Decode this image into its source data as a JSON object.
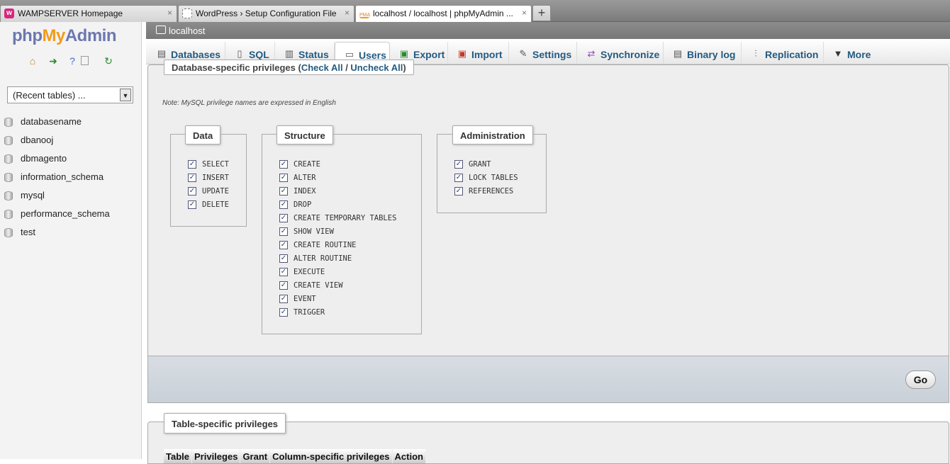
{
  "browser": {
    "tabs": [
      {
        "title": "WAMPSERVER Homepage",
        "close": "×"
      },
      {
        "title": "WordPress › Setup Configuration File",
        "close": "×"
      },
      {
        "title": "localhost / localhost | phpMyAdmin ...",
        "close": "×"
      }
    ],
    "new_tab": "+"
  },
  "sidebar": {
    "logo": {
      "php": "php",
      "my": "My",
      "admin": "Admin"
    },
    "recent_tables": "(Recent tables) ...",
    "databases": [
      "databasename",
      "dbanooj",
      "dbmagento",
      "information_schema",
      "mysql",
      "performance_schema",
      "test"
    ]
  },
  "server": {
    "name": "localhost"
  },
  "menu": [
    "Databases",
    "SQL",
    "Status",
    "Users",
    "Export",
    "Import",
    "Settings",
    "Synchronize",
    "Binary log",
    "Replication",
    "More"
  ],
  "db_privileges": {
    "legend": "Database-specific privileges",
    "check_all": "Check All",
    "separator": " / ",
    "uncheck_all": "Uncheck All",
    "note": "Note: MySQL privilege names are expressed in English",
    "groups": {
      "data": {
        "label": "Data",
        "items": [
          "SELECT",
          "INSERT",
          "UPDATE",
          "DELETE"
        ]
      },
      "structure": {
        "label": "Structure",
        "items": [
          "CREATE",
          "ALTER",
          "INDEX",
          "DROP",
          "CREATE TEMPORARY TABLES",
          "SHOW VIEW",
          "CREATE ROUTINE",
          "ALTER ROUTINE",
          "EXECUTE",
          "CREATE VIEW",
          "EVENT",
          "TRIGGER"
        ]
      },
      "administration": {
        "label": "Administration",
        "items": [
          "GRANT",
          "LOCK TABLES",
          "REFERENCES"
        ]
      }
    },
    "go": "Go"
  },
  "table_privileges": {
    "legend": "Table-specific privileges",
    "columns": [
      "Table",
      "Privileges",
      "Grant",
      "Column-specific privileges",
      "Action"
    ]
  },
  "colors": {
    "link": "#235a81",
    "logo_accent": "#f29b1a",
    "logo_primary": "#6c78af"
  }
}
